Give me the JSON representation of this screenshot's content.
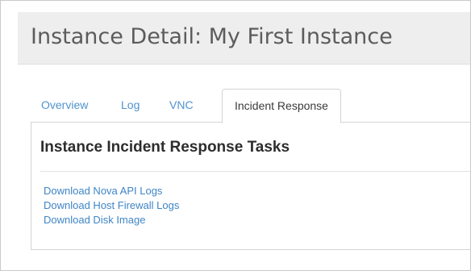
{
  "page": {
    "title": "Instance Detail: My First Instance"
  },
  "tabs": [
    {
      "label": "Overview",
      "active": false
    },
    {
      "label": "Log",
      "active": false
    },
    {
      "label": "VNC",
      "active": false
    },
    {
      "label": "Incident Response",
      "active": true
    }
  ],
  "panel": {
    "title": "Instance Incident Response Tasks",
    "links": [
      {
        "label": "Download Nova API Logs"
      },
      {
        "label": "Download Host Firewall Logs"
      },
      {
        "label": "Download Disk Image"
      }
    ]
  },
  "colors": {
    "link": "#3f85c6",
    "tab_link": "#4f93ce",
    "header_background": "#eeeeee",
    "title_text": "#5c5c5c"
  }
}
